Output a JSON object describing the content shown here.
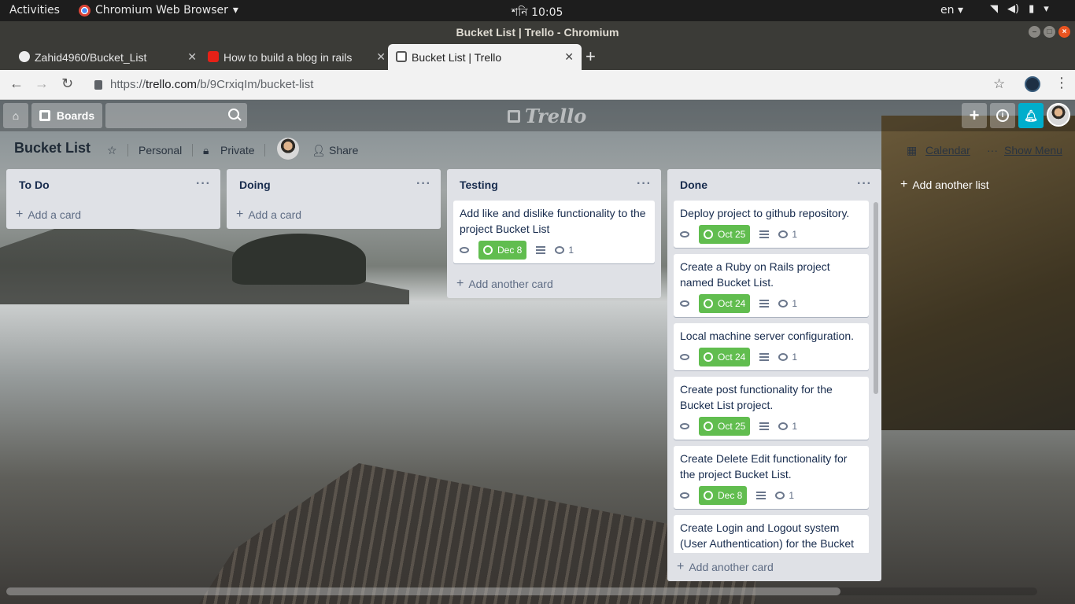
{
  "system_bar": {
    "activities": "Activities",
    "app_name": "Chromium Web Browser",
    "clock": "শনি 10:05",
    "lang": "en"
  },
  "window": {
    "title": "Bucket List | Trello - Chromium"
  },
  "tabs": [
    {
      "label": "Zahid4960/Bucket_List",
      "favicon": "github-icon"
    },
    {
      "label": "How to build a blog in rails",
      "favicon": "youtube-icon"
    },
    {
      "label": "Bucket List | Trello",
      "favicon": "trello-icon",
      "active": true
    }
  ],
  "address": {
    "scheme": "https://",
    "host": "trello.com",
    "path": "/b/9CrxiqIm/bucket-list"
  },
  "trello_header": {
    "boards_label": "Boards",
    "logo_text": "Trello",
    "search_value": ""
  },
  "board": {
    "title": "Bucket List",
    "team": "Personal",
    "visibility": "Private",
    "share": "Share",
    "calendar": "Calendar",
    "show_menu": "Show Menu"
  },
  "lists": {
    "todo": {
      "title": "To Do",
      "add_card": "Add a card"
    },
    "doing": {
      "title": "Doing",
      "add_card": "Add a card"
    },
    "testing": {
      "title": "Testing",
      "add_card": "Add another card",
      "cards": [
        {
          "title": "Add like and dislike functionality to the project Bucket List",
          "due": "Dec 8",
          "comments": "1"
        }
      ]
    },
    "done": {
      "title": "Done",
      "add_card": "Add another card",
      "cards": [
        {
          "title": "Deploy project to github repository.",
          "due": "Oct 25",
          "comments": "1"
        },
        {
          "title": "Create a Ruby on Rails project named Bucket List.",
          "due": "Oct 24",
          "comments": "1"
        },
        {
          "title": "Local machine server configuration.",
          "due": "Oct 24",
          "comments": "1"
        },
        {
          "title": "Create post functionality for the Bucket List project.",
          "due": "Oct 25",
          "comments": "1"
        },
        {
          "title": "Create Delete Edit functionality for the project Bucket List.",
          "due": "Dec 8",
          "comments": "1"
        },
        {
          "title": "Create Login and Logout system (User Authentication) for the Bucket"
        }
      ]
    }
  },
  "add_list": "Add another list",
  "colors": {
    "due_green": "#61bd4f",
    "notification_blue": "#00aecc",
    "list_bg": "#dfe1e6"
  }
}
